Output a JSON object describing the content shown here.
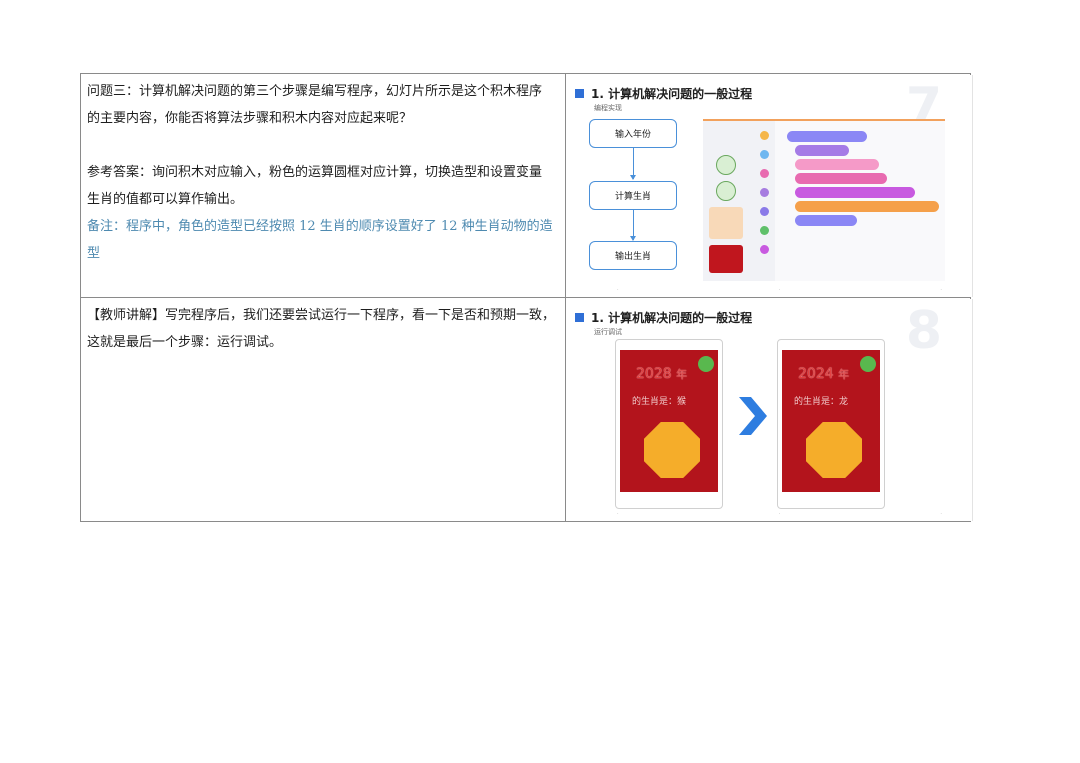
{
  "row1": {
    "lines": [
      "问题三：计算机解决问题的第三个步骤是编写程序，幻灯片所示是这个积木程序",
      "的主要内容，你能否将算法步骤和积木内容对应起来呢？",
      "参考答案：询问积木对应输入，粉色的运算圆框对应计算，切换造型和设置变量",
      "生肖的值都可以算作输出。"
    ],
    "note": "备注：程序中，角色的造型已经按照 12 生肖的顺序设置好了 12 种生肖动物的造型",
    "slide": {
      "title": "1. 计算机解决问题的一般过程",
      "subtitle": "编程实现",
      "number": "7",
      "flow": [
        "输入年份",
        "计算生肖",
        "输出生肖"
      ]
    }
  },
  "row2": {
    "lines": [
      "【教师讲解】写完程序后，我们还要尝试运行一下程序，看一下是否和预期一致，",
      "这就是最后一个步骤：运行调试。"
    ],
    "slide": {
      "title": "1. 计算机解决问题的一般过程",
      "subtitle": "运行调试",
      "number": "8",
      "left_phone": {
        "year": "2028",
        "year_suffix": "年",
        "zodiac": "的生肖是：猴"
      },
      "right_phone": {
        "year": "2024",
        "year_suffix": "年",
        "zodiac": "的生肖是：龙"
      }
    }
  },
  "colors": {
    "note": "#4e8ab0",
    "accent_blue": "#2f6fd6",
    "red_screen": "#b3141c",
    "octagon": "#f5ad2a"
  }
}
